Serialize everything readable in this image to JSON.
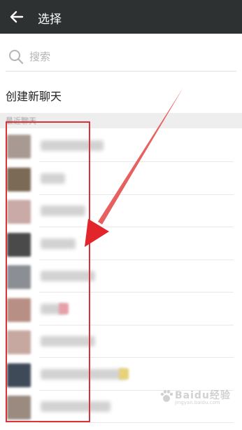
{
  "header": {
    "title": "选择",
    "back_icon": "arrow-left-icon"
  },
  "search": {
    "placeholder": "搜索",
    "icon": "search-icon"
  },
  "new_chat": {
    "label": "创建新聊天"
  },
  "recent_section": {
    "label": "最近聊天"
  },
  "recent_chats": [
    {
      "avatar_color": "#a89a92",
      "name_width": 90
    },
    {
      "avatar_color": "#7b6a55",
      "name_width": 35
    },
    {
      "avatar_color": "#c9aaa6",
      "name_width": 64
    },
    {
      "avatar_color": "#4a4a4a",
      "name_width": 50
    },
    {
      "avatar_color": "#8b8f95",
      "name_width": 78
    },
    {
      "avatar_color": "#b88f84",
      "name_width": 36,
      "accent_color": "#e8a0a8"
    },
    {
      "avatar_color": "#c7a8a0",
      "name_width": 78
    },
    {
      "avatar_color": "#3f4a58",
      "name_width": 122,
      "accent_color": "#e7d27a"
    },
    {
      "avatar_color": "#9a8a80",
      "name_width": 100
    }
  ],
  "annotation": {
    "highlight_color": "#d9343a"
  },
  "watermark": {
    "text": "Baidu经验",
    "url": "jingyan.baidu.com"
  }
}
